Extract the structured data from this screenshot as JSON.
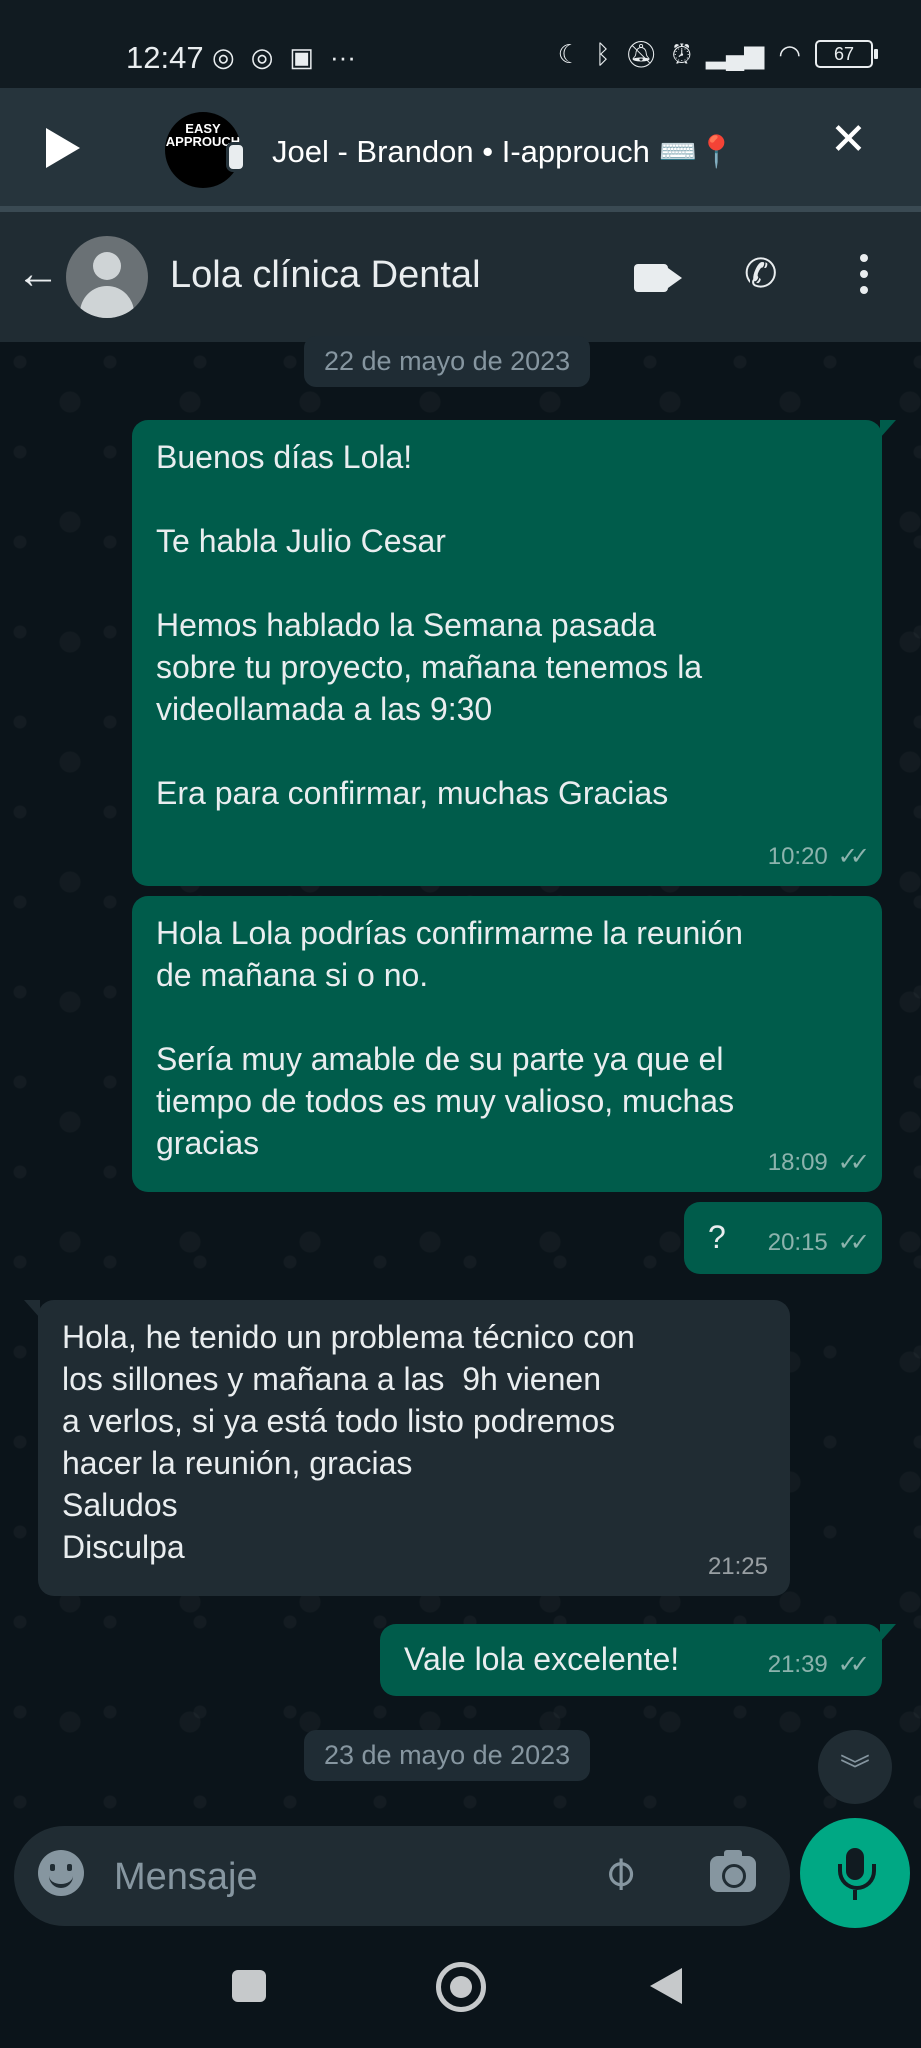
{
  "status_bar": {
    "time": "12:47",
    "battery": "67"
  },
  "voice_playback": {
    "avatar_text": "EASY APPROUCH",
    "title": "Joel - Brandon • I-approuch ⌨️📍"
  },
  "header": {
    "contact_name": "Lola clínica Dental"
  },
  "chat": {
    "date_chips": [
      "22 de mayo de 2023",
      "23 de mayo de 2023"
    ],
    "messages": [
      {
        "direction": "out",
        "text": "Buenos días Lola!\n\nTe habla Julio Cesar\n\nHemos hablado la Semana pasada\nsobre tu proyecto, mañana tenemos la\nvideollamada a las 9:30\n\nEra para confirmar, muchas Gracias",
        "time": "10:20",
        "ticks": "✓✓"
      },
      {
        "direction": "out",
        "text": "Hola Lola podrías confirmarme la reunión\nde mañana si o no.\n\nSería muy amable de su parte ya que el\ntiempo de todos es muy valioso, muchas\ngracias",
        "time": "18:09",
        "ticks": "✓✓"
      },
      {
        "direction": "out",
        "text": "?",
        "time": "20:15",
        "ticks": "✓✓"
      },
      {
        "direction": "in",
        "text": "Hola, he tenido un problema técnico con\nlos sillones y mañana a las  9h vienen\na verlos, si ya está todo listo podremos\nhacer la reunión, gracias\nSaludos\nDisculpa",
        "time": "21:25"
      },
      {
        "direction": "out",
        "text": "Vale lola excelente!",
        "time": "21:39",
        "ticks": "✓✓"
      }
    ]
  },
  "composer": {
    "placeholder": "Mensaje"
  },
  "colors": {
    "outgoing_bubble": "#005c4b",
    "incoming_bubble": "#202c33",
    "accent": "#00a884",
    "background": "#0b141a"
  },
  "icons": [
    "messenger-icon",
    "instagram-icon",
    "moon-icon",
    "bluetooth-icon",
    "alarm-icon",
    "wifi-icon",
    "play-icon",
    "close-icon",
    "back-arrow-icon",
    "video-call-icon",
    "phone-icon",
    "more-vert-icon",
    "emoji-icon",
    "attach-icon",
    "camera-icon",
    "mic-icon",
    "chevron-down-icon"
  ]
}
